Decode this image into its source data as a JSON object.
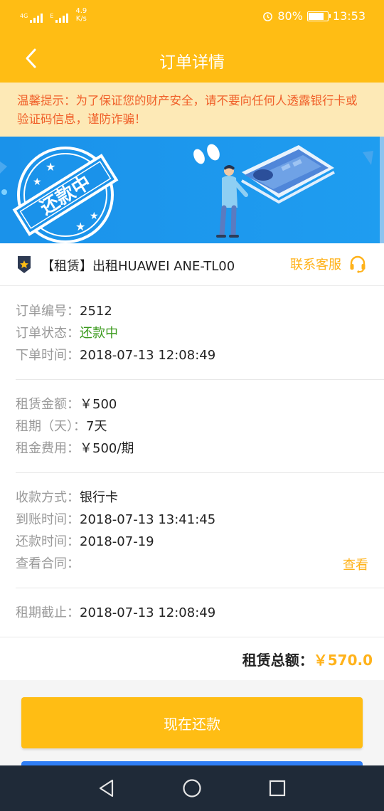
{
  "status_bar": {
    "signal_tag_1": "4G",
    "signal_tag_2": "E",
    "network_speed": "4.9",
    "network_unit": "K/s",
    "battery": "80%",
    "battery_level": 0.8,
    "time": "13:53"
  },
  "nav": {
    "title": "订单详情"
  },
  "notice": {
    "text": "温馨提示：为了保证您的财产安全，请不要向任何人透露银行卡或验证码信息，谨防诈骗！"
  },
  "banner": {
    "stamp_text": "还款中"
  },
  "product": {
    "name": "【租赁】出租HUAWEI ANE-TL00",
    "contact_label": "联系客服"
  },
  "order_info": [
    {
      "label": "订单编号：",
      "value": "2512"
    },
    {
      "label": "订单状态：",
      "value": "还款中"
    },
    {
      "label": "下单时间：",
      "value": "2018-07-13 12:08:49"
    }
  ],
  "rent_info": [
    {
      "label": "租赁金额：",
      "value": "￥500"
    },
    {
      "label": "租期（天）：",
      "value": "7天"
    },
    {
      "label": "租金费用：",
      "value": "￥500/期"
    }
  ],
  "payment_info": [
    {
      "label": "收款方式：",
      "value": "银行卡"
    },
    {
      "label": "到账时间：",
      "value": "2018-07-13 13:41:45"
    },
    {
      "label": "还款时间：",
      "value": "2018-07-19"
    },
    {
      "label": "查看合同：",
      "value": ""
    }
  ],
  "view_contract": "查看",
  "deadline": {
    "label": "租期截止：",
    "value": "2018-07-13 12:08:49"
  },
  "total": {
    "label": "租赁总额：",
    "value": "￥570.0"
  },
  "pay_button": "现在还款",
  "colors": {
    "brand_yellow": "#ffbd14",
    "notice_bg": "#fde9b6",
    "notice_text": "#f0602a",
    "status_green": "#3a9a1c",
    "banner_blue": "#1a92ea"
  }
}
